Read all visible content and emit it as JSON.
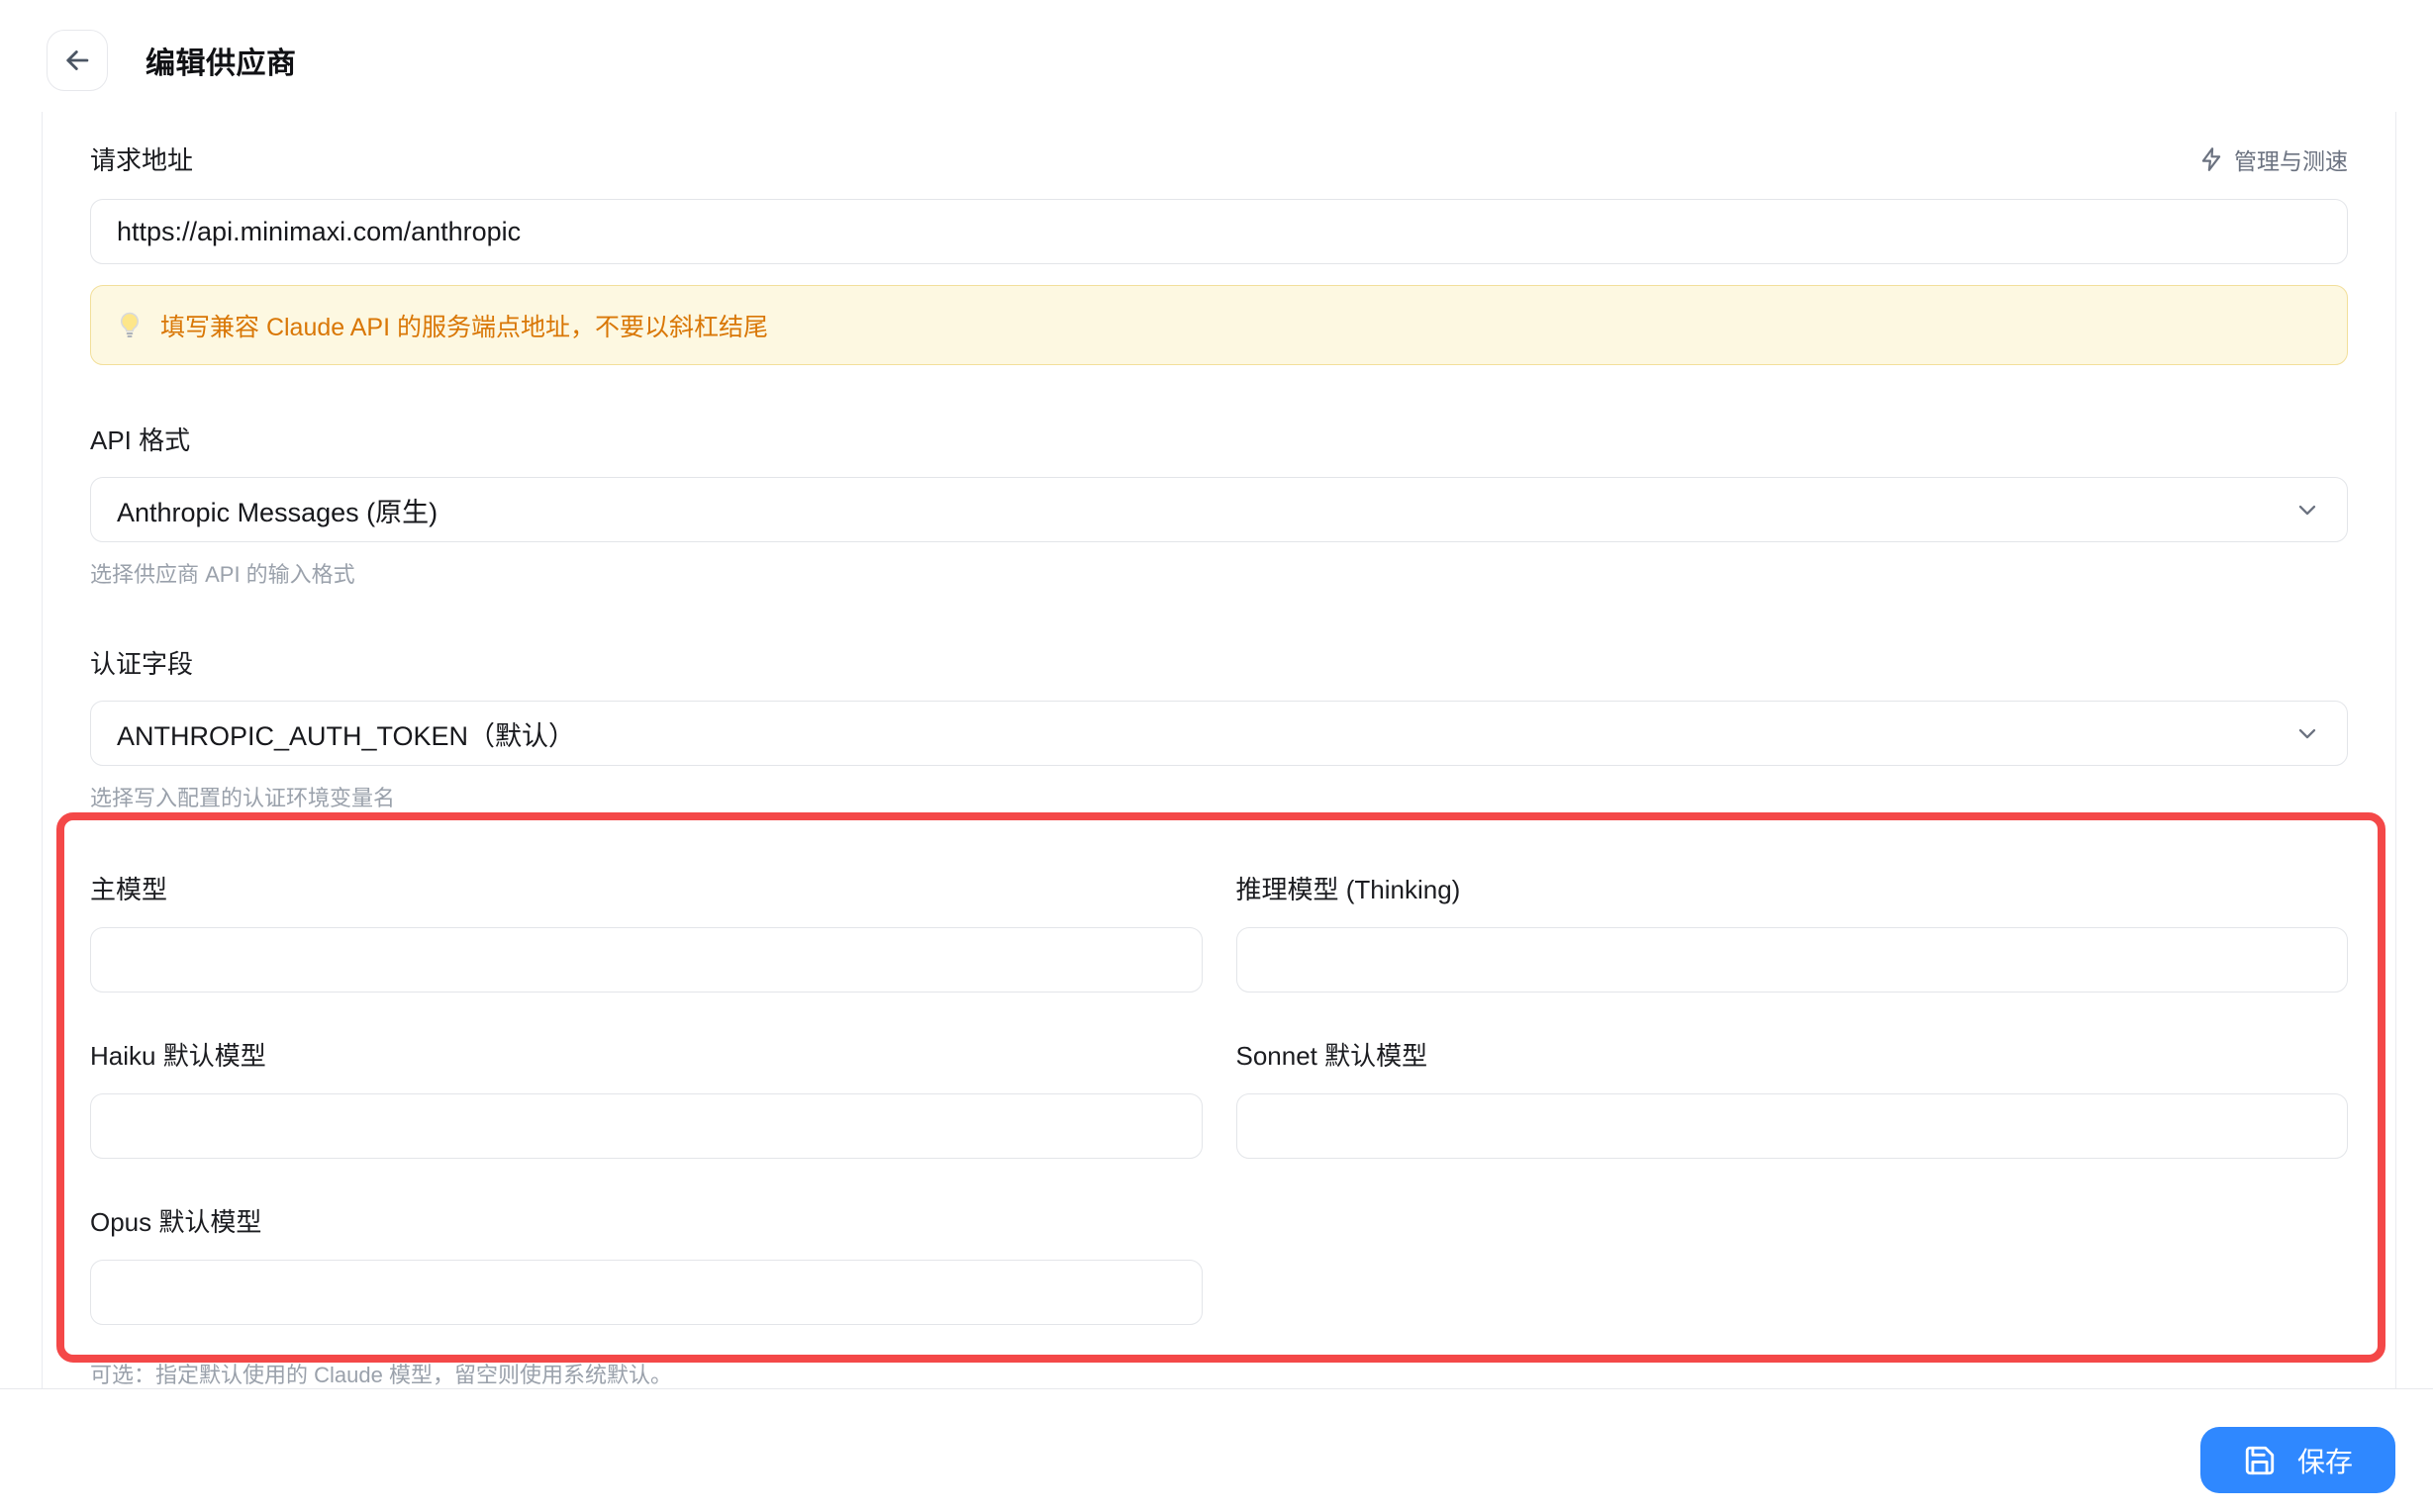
{
  "header": {
    "title": "编辑供应商"
  },
  "form": {
    "request_url": {
      "label": "请求地址",
      "value": "https://api.minimaxi.com/anthropic",
      "action_label": "管理与测速",
      "tip": "填写兼容 Claude API 的服务端点地址，不要以斜杠结尾"
    },
    "api_format": {
      "label": "API 格式",
      "value": "Anthropic Messages (原生)",
      "helper": "选择供应商 API 的输入格式"
    },
    "auth_field": {
      "label": "认证字段",
      "value": "ANTHROPIC_AUTH_TOKEN（默认）",
      "helper": "选择写入配置的认证环境变量名"
    },
    "models": {
      "fields": [
        {
          "label": "主模型",
          "value": ""
        },
        {
          "label": "推理模型 (Thinking)",
          "value": ""
        },
        {
          "label": "Haiku 默认模型",
          "value": ""
        },
        {
          "label": "Sonnet 默认模型",
          "value": ""
        },
        {
          "label": "Opus 默认模型",
          "value": ""
        }
      ],
      "helper": "可选：指定默认使用的 Claude 模型，留空则使用系统默认。"
    }
  },
  "footer": {
    "save_label": "保存"
  },
  "icons": {
    "back": "arrow-left-icon",
    "speed": "lightning-icon",
    "tip": "lightbulb-icon",
    "dropdown": "chevron-down-icon",
    "save": "floppy-disk-icon"
  },
  "colors": {
    "accent_blue": "#2f88ff",
    "annotation_red": "#f44848",
    "tip_text": "#d97706",
    "tip_background": "#fdf8e1",
    "tip_border": "#f2df9a"
  }
}
